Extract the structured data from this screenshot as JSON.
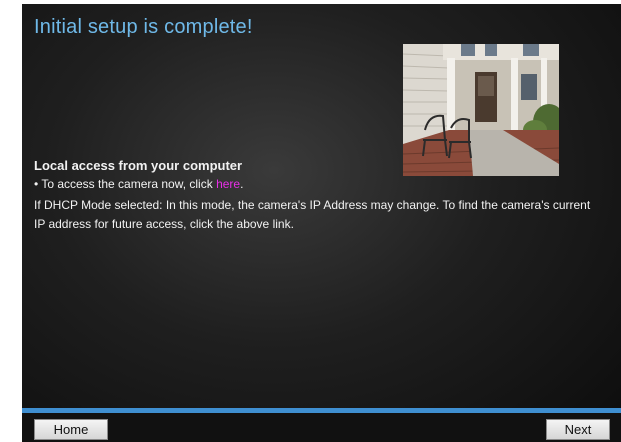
{
  "page": {
    "title": "Initial setup is complete!"
  },
  "local_access": {
    "heading": "Local access from your computer",
    "bullet_prefix": "• To access the camera now, click ",
    "link_label": "here",
    "bullet_suffix": ".",
    "dhcp_note": "If DHCP Mode selected: In this mode, the camera's IP Address may change. To find the camera's current IP address for future access, click the above link."
  },
  "footer": {
    "home_label": "Home",
    "next_label": "Next"
  },
  "colors": {
    "title": "#6fb9e8",
    "link": "#e62fe6",
    "accent_bar": "#3f8fd1"
  },
  "icons": {
    "photo": "house-porch-photo"
  }
}
